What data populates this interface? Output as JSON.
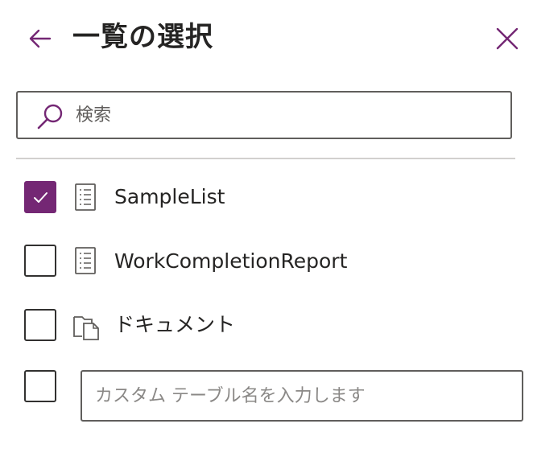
{
  "header": {
    "title": "一覧の選択",
    "back_icon": "arrow-left-icon",
    "close_icon": "close-icon"
  },
  "search": {
    "placeholder": "検索",
    "value": "",
    "icon": "search-icon"
  },
  "items": [
    {
      "label": "SampleList",
      "checked": true,
      "icon": "list-icon"
    },
    {
      "label": "WorkCompletionReport",
      "checked": false,
      "icon": "list-icon"
    },
    {
      "label": "ドキュメント",
      "checked": false,
      "icon": "document-library-icon"
    }
  ],
  "custom_table": {
    "checked": false,
    "placeholder": "カスタム テーブル名を入力します",
    "value": ""
  },
  "colors": {
    "accent": "#742774",
    "text": "#252423",
    "border": "#605e5c"
  }
}
